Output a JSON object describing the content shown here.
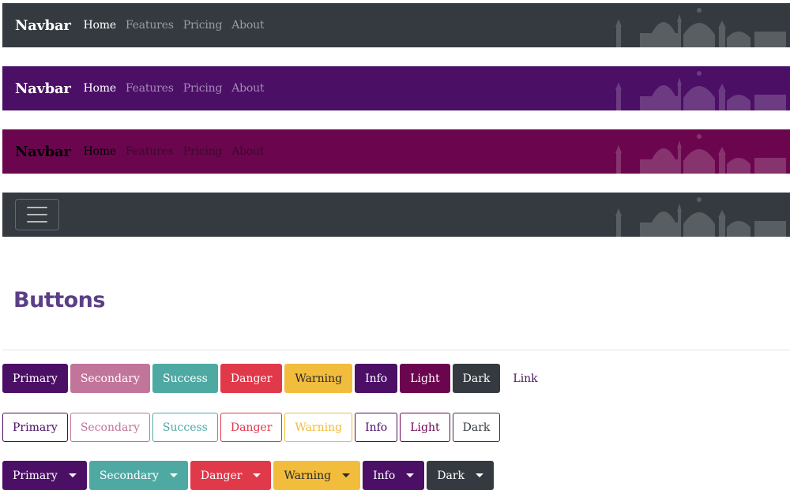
{
  "navbars": [
    {
      "bg": "#343a40",
      "brand": "Navbar",
      "brand_color": "#ffffff",
      "links": [
        {
          "label": "Home",
          "color": "#ffffff"
        },
        {
          "label": "Features",
          "color": "#9a9da2"
        },
        {
          "label": "Pricing",
          "color": "#9a9da2"
        },
        {
          "label": "About",
          "color": "#9a9da2"
        }
      ]
    },
    {
      "bg": "#4b0f66",
      "brand": "Navbar",
      "brand_color": "#ffffff",
      "links": [
        {
          "label": "Home",
          "color": "#ffffff"
        },
        {
          "label": "Features",
          "color": "#a58bb6"
        },
        {
          "label": "Pricing",
          "color": "#a58bb6"
        },
        {
          "label": "About",
          "color": "#a58bb6"
        }
      ]
    },
    {
      "bg": "#6b064e",
      "brand": "Navbar",
      "brand_color": "#000000",
      "links": [
        {
          "label": "Home",
          "color": "#000000"
        },
        {
          "label": "Features",
          "color": "#3a0a2c"
        },
        {
          "label": "Pricing",
          "color": "#3a0a2c"
        },
        {
          "label": "About",
          "color": "#3a0a2c"
        }
      ]
    }
  ],
  "collapsed_navbar": {
    "bg": "#343a40",
    "toggler_icon": "hamburger-icon"
  },
  "section": {
    "title": "Buttons"
  },
  "solid_buttons": [
    {
      "label": "Primary",
      "bg": "#4b0f66",
      "color": "#ffffff"
    },
    {
      "label": "Secondary",
      "bg": "#c2759a",
      "color": "#ffffff"
    },
    {
      "label": "Success",
      "bg": "#4fa9a3",
      "color": "#ffffff"
    },
    {
      "label": "Danger",
      "bg": "#e0394a",
      "color": "#ffffff"
    },
    {
      "label": "Warning",
      "bg": "#f2bc3d",
      "color": "#2a2a2a"
    },
    {
      "label": "Info",
      "bg": "#4b0f66",
      "color": "#ffffff"
    },
    {
      "label": "Light",
      "bg": "#6b064e",
      "color": "#ffffff"
    },
    {
      "label": "Dark",
      "bg": "#343a40",
      "color": "#ffffff"
    },
    {
      "label": "Link",
      "bg": "transparent",
      "color": "#4a1a5e"
    }
  ],
  "outline_buttons": [
    {
      "label": "Primary",
      "color": "#4b0f66"
    },
    {
      "label": "Secondary",
      "color": "#c2759a"
    },
    {
      "label": "Success",
      "color": "#4fa9a3"
    },
    {
      "label": "Danger",
      "color": "#e0394a"
    },
    {
      "label": "Warning",
      "color": "#f2bc3d"
    },
    {
      "label": "Info",
      "color": "#4b0f66"
    },
    {
      "label": "Light",
      "color": "#6b064e"
    },
    {
      "label": "Dark",
      "color": "#343a40"
    }
  ],
  "dropdown_buttons": [
    {
      "label": "Primary",
      "bg": "#4b0f66",
      "color": "#ffffff"
    },
    {
      "label": "Secondary",
      "bg": "#4fa9a3",
      "color": "#ffffff"
    },
    {
      "label": "Danger",
      "bg": "#e0394a",
      "color": "#ffffff"
    },
    {
      "label": "Warning",
      "bg": "#f2bc3d",
      "color": "#2a2a2a"
    },
    {
      "label": "Info",
      "bg": "#4b0f66",
      "color": "#ffffff"
    },
    {
      "label": "Dark",
      "bg": "#343a40",
      "color": "#ffffff"
    }
  ]
}
